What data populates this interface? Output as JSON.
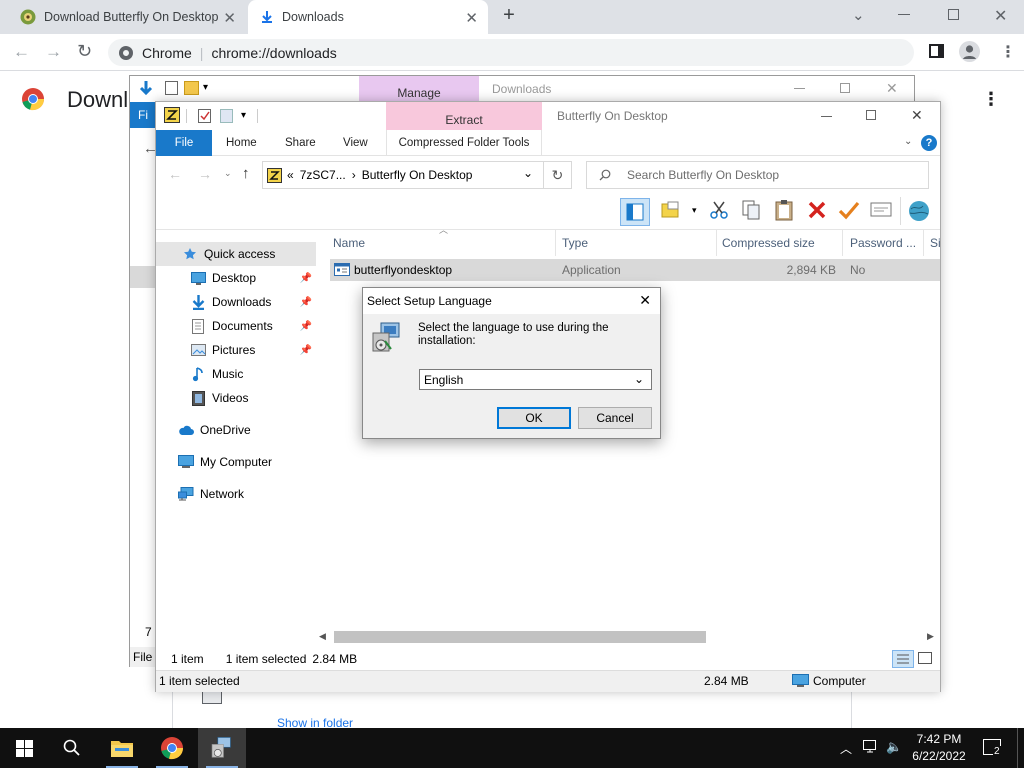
{
  "browser": {
    "tabs": [
      {
        "title": "Download Butterfly On Desktop",
        "active": false
      },
      {
        "title": "Downloads",
        "active": true
      }
    ],
    "new_tab_symbol": "+",
    "omnibox_site": "Chrome",
    "omnibox_url": "chrome://downloads",
    "page_title": "Downl",
    "show_in_folder": "Show in folder"
  },
  "back_window": {
    "manage_label": "Manage",
    "title": "Downloads",
    "file_tab": "Fi",
    "item_count": "7 i",
    "file_status": "File"
  },
  "explorer": {
    "title": "Butterfly On Desktop",
    "context_tab": "Extract",
    "ribbon_tabs": [
      "File",
      "Home",
      "Share",
      "View",
      "Compressed Folder Tools"
    ],
    "address_parts": [
      "«",
      "7zSC7...",
      "›",
      "Butterfly On Desktop"
    ],
    "search_placeholder": "Search Butterfly On Desktop",
    "nav": [
      {
        "label": "Quick access",
        "icon": "star-icon",
        "pinned": false,
        "indent": 0,
        "selected": true
      },
      {
        "label": "Desktop",
        "icon": "desktop-icon",
        "pinned": true,
        "indent": 1
      },
      {
        "label": "Downloads",
        "icon": "download-arrow-icon",
        "pinned": true,
        "indent": 1
      },
      {
        "label": "Documents",
        "icon": "document-icon",
        "pinned": true,
        "indent": 1
      },
      {
        "label": "Pictures",
        "icon": "pictures-icon",
        "pinned": true,
        "indent": 1
      },
      {
        "label": "Music",
        "icon": "music-icon",
        "pinned": false,
        "indent": 1
      },
      {
        "label": "Videos",
        "icon": "video-icon",
        "pinned": false,
        "indent": 1
      },
      {
        "label": "OneDrive",
        "icon": "cloud-icon",
        "pinned": false,
        "indent": 0
      },
      {
        "label": "My Computer",
        "icon": "computer-icon",
        "pinned": false,
        "indent": 0
      },
      {
        "label": "Network",
        "icon": "network-icon",
        "pinned": false,
        "indent": 0
      }
    ],
    "columns": [
      "Name",
      "Type",
      "Compressed size",
      "Password ...",
      "Si"
    ],
    "rows": [
      {
        "name": "butterflyondesktop",
        "type": "Application",
        "size": "2,894 KB",
        "password": "No"
      }
    ],
    "status": {
      "count": "1 item",
      "selected": "1 item selected",
      "size": "2.84 MB"
    },
    "bottom": {
      "selected": "1 item selected",
      "size": "2.84 MB",
      "location": "Computer"
    }
  },
  "dialog": {
    "title": "Select Setup Language",
    "message": "Select the language to use during the installation:",
    "language": "English",
    "ok": "OK",
    "cancel": "Cancel"
  },
  "taskbar": {
    "time": "7:42 PM",
    "date": "6/22/2022",
    "notification_count": "2"
  },
  "colors": {
    "accent": "#1979ca",
    "manage_tab": "#e8c8f0",
    "extract_tab": "#f8c8dc",
    "taskbar": "#101010"
  }
}
